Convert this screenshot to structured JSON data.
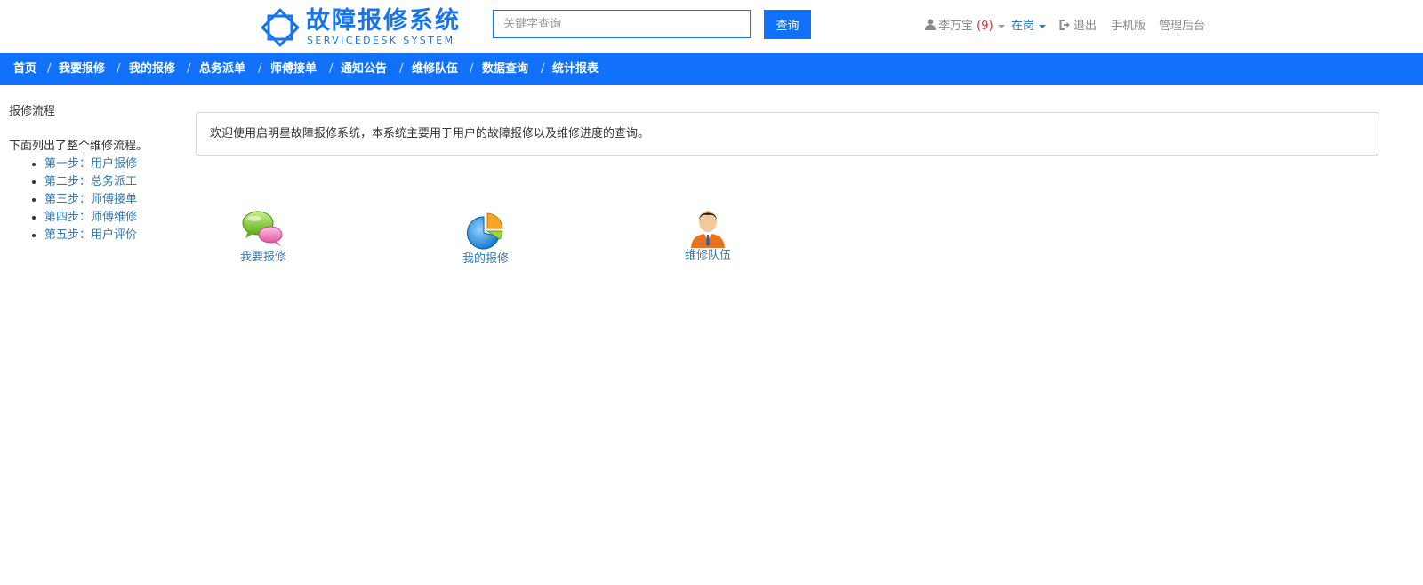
{
  "header": {
    "logo": {
      "title": "故障报修系统",
      "subtitle": "SERVICEDESK SYSTEM",
      "color": "#1874ee",
      "icon": "diamond-logo-icon"
    },
    "search": {
      "placeholder": "关键字查询",
      "value": "",
      "button_label": "查询"
    },
    "user": {
      "icon": "user-icon",
      "name": "李万宝",
      "count": "(9)"
    },
    "status": {
      "label": "在岗"
    },
    "logout": {
      "icon": "sign-out-icon",
      "label": "退出"
    },
    "mobile": {
      "label": "手机版"
    },
    "admin": {
      "label": "管理后台"
    }
  },
  "nav": {
    "background": "#1171fb",
    "separator": "/",
    "items": [
      "首页",
      "我要报修",
      "我的报修",
      "总务派单",
      "师傅接单",
      "通知公告",
      "维修队伍",
      "数据查询",
      "统计报表"
    ]
  },
  "sidebar": {
    "title": "报修流程",
    "description": "下面列出了整个维修流程。",
    "steps": [
      "第一步：用户报修",
      "第二步：总务派工",
      "第三步：师傅接单",
      "第四步：师傅维修",
      "第五步：用户评价"
    ]
  },
  "welcome": {
    "text": "欢迎使用启明星故障报修系统，本系统主要用于用户的故障报修以及维修进度的查询。"
  },
  "quick_links": [
    {
      "icon": "chat-bubbles-icon",
      "label": "我要报修"
    },
    {
      "icon": "pie-chart-icon",
      "label": "我的报修"
    },
    {
      "icon": "person-icon",
      "label": "维修队伍"
    }
  ]
}
